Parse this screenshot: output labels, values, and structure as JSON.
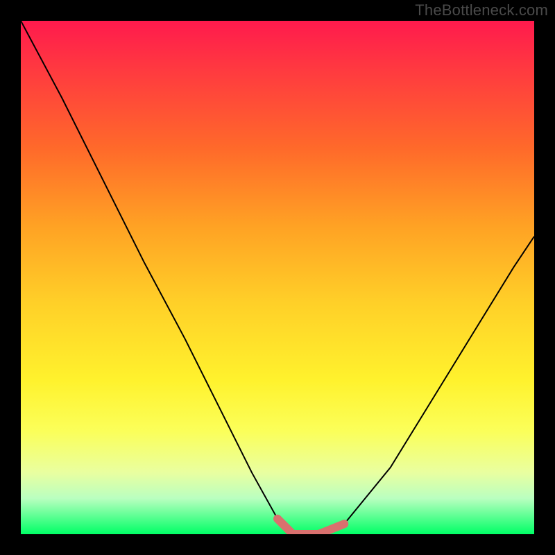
{
  "watermark": "TheBottleneck.com",
  "chart_data": {
    "type": "line",
    "title": "",
    "xlabel": "",
    "ylabel": "",
    "xlim": [
      0,
      100
    ],
    "ylim": [
      0,
      100
    ],
    "grid": false,
    "legend": false,
    "series": [
      {
        "name": "bottleneck-curve",
        "x": [
          0,
          8,
          16,
          24,
          32,
          40,
          45,
          50,
          53,
          58,
          63,
          72,
          80,
          88,
          96,
          100
        ],
        "values": [
          100,
          85,
          69,
          53,
          38,
          22,
          12,
          3,
          0,
          0,
          2,
          13,
          26,
          39,
          52,
          58
        ]
      },
      {
        "name": "optimal-marker",
        "x": [
          50,
          53,
          58,
          63
        ],
        "values": [
          3,
          0,
          0,
          2
        ]
      }
    ],
    "annotations": []
  },
  "colors": {
    "curve": "#000000",
    "marker": "#d9706e",
    "background_top": "#ff1a4d",
    "background_bottom": "#00ff66",
    "frame": "#000000"
  }
}
